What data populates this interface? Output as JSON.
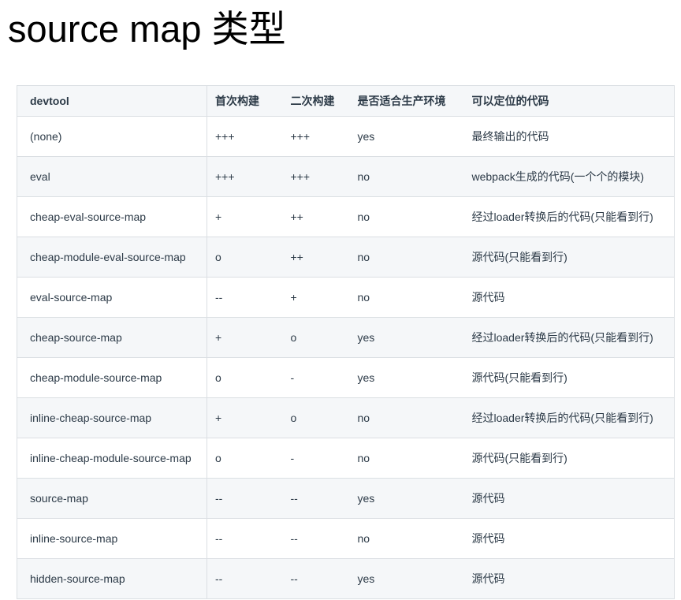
{
  "page": {
    "title": "source map 类型"
  },
  "table": {
    "columns": [
      "devtool",
      "首次构建",
      "二次构建",
      "是否适合生产环境",
      "可以定位的代码"
    ],
    "rows": [
      [
        "(none)",
        "+++",
        "+++",
        "yes",
        "最终输出的代码"
      ],
      [
        "eval",
        "+++",
        "+++",
        "no",
        "webpack生成的代码(一个个的模块)"
      ],
      [
        "cheap-eval-source-map",
        "+",
        "++",
        "no",
        "经过loader转换后的代码(只能看到行)"
      ],
      [
        "cheap-module-eval-source-map",
        "o",
        "++",
        "no",
        "源代码(只能看到行)"
      ],
      [
        "eval-source-map",
        "--",
        "+",
        "no",
        "源代码"
      ],
      [
        "cheap-source-map",
        "+",
        "o",
        "yes",
        "经过loader转换后的代码(只能看到行)"
      ],
      [
        "cheap-module-source-map",
        "o",
        "-",
        "yes",
        "源代码(只能看到行)"
      ],
      [
        "inline-cheap-source-map",
        "+",
        "o",
        "no",
        "经过loader转换后的代码(只能看到行)"
      ],
      [
        "inline-cheap-module-source-map",
        "o",
        "-",
        "no",
        "源代码(只能看到行)"
      ],
      [
        "source-map",
        "--",
        "--",
        "yes",
        "源代码"
      ],
      [
        "inline-source-map",
        "--",
        "--",
        "no",
        "源代码"
      ],
      [
        "hidden-source-map",
        "--",
        "--",
        "yes",
        "源代码"
      ]
    ]
  },
  "colors": {
    "border": "#dbdfe3",
    "stripe_bg": "#f5f7f9",
    "header_bg": "#f5f7f9",
    "text": "#2c3a47",
    "title": "#000000"
  }
}
